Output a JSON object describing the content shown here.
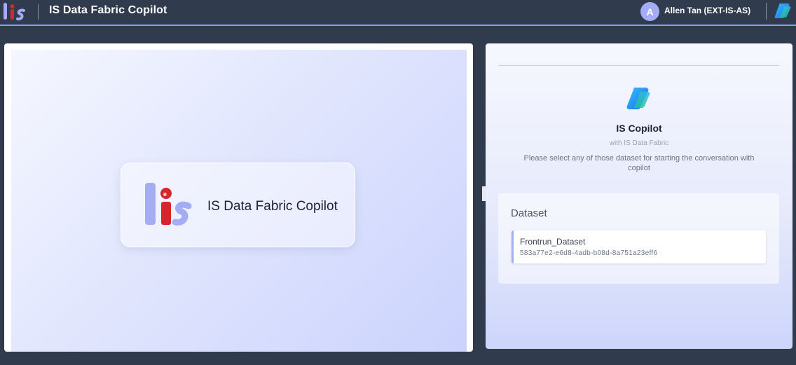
{
  "header": {
    "app_title": "IS Data Fabric Copilot",
    "user_initial": "A",
    "user_name": "Allen Tan (EXT-IS-AS)",
    "logo_icon": "is-logo-icon",
    "copilot_icon": "copilot-icon"
  },
  "left_panel": {
    "card_title": "IS Data Fabric Copilot"
  },
  "right_panel": {
    "title": "IS Copilot",
    "subtitle": "with IS Data Fabric",
    "instruction": "Please select any of those dataset for starting the conversation with copilot",
    "dataset": {
      "heading": "Dataset",
      "items": [
        {
          "name": "Frontrun_Dataset",
          "id": "583a77e2-e6d8-4adb-b08d-8a751a23eff6"
        }
      ]
    }
  },
  "colors": {
    "header_bg": "#303c4e",
    "accent": "#a3acf5",
    "brand_red": "#d7252d"
  }
}
